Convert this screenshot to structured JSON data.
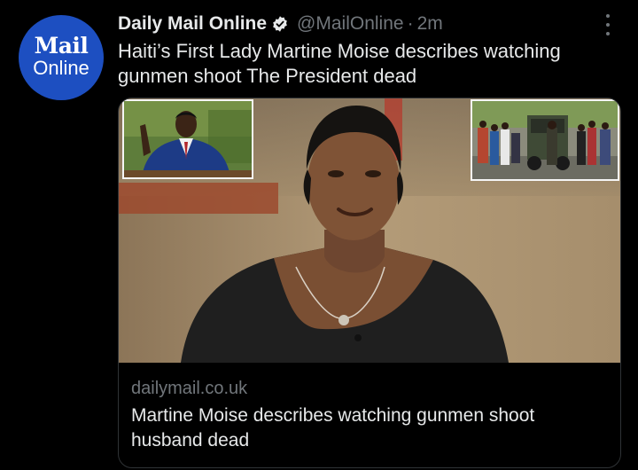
{
  "tweet": {
    "avatar": {
      "line1": "Mail",
      "line2": "Online",
      "bg": "#1d4fc1"
    },
    "display_name": "Daily Mail Online",
    "handle": "@MailOnline",
    "separator": "·",
    "time": "2m",
    "text": "Haiti’s First Lady Martine Moise describes watching gunmen shoot The President dead",
    "verified_icon": "verified-badge-icon",
    "more_icon": "more-options-icon"
  },
  "card": {
    "domain": "dailymail.co.uk",
    "title": "Martine Moise describes watching gunmen shoot husband dead"
  },
  "colors": {
    "background": "#000000",
    "text": "#e7e9ea",
    "secondary": "#71767b",
    "border": "#2f3336"
  }
}
